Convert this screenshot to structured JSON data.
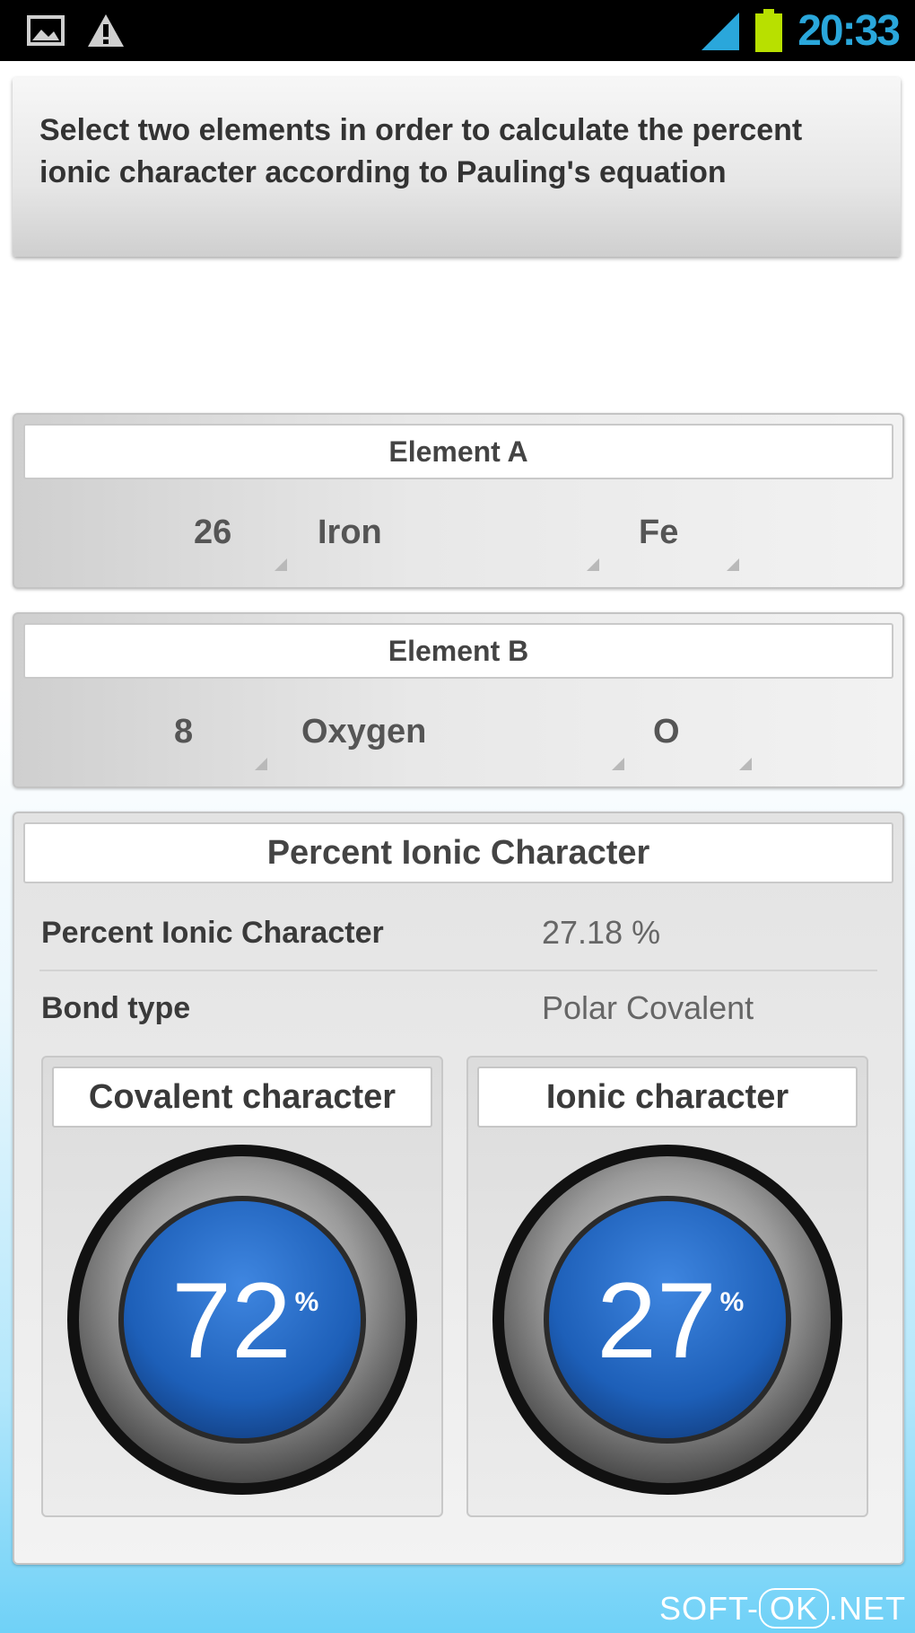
{
  "status_bar": {
    "time": "20:33",
    "icons": [
      "picture-icon",
      "warning-icon",
      "signal-icon",
      "battery-icon"
    ],
    "accent_color": "#2aa7db"
  },
  "instruction": {
    "text": "Select two elements in order to calculate the percent ionic character according to Pauling's equation"
  },
  "element_a": {
    "header": "Element A",
    "atomic_number": "26",
    "name": "Iron",
    "symbol": "Fe"
  },
  "element_b": {
    "header": "Element B",
    "atomic_number": "8",
    "name": "Oxygen",
    "symbol": "O"
  },
  "results": {
    "header": "Percent Ionic Character",
    "percent_label": "Percent Ionic Character",
    "percent_value": "27.18 %",
    "bond_label": "Bond type",
    "bond_value": "Polar Covalent",
    "covalent": {
      "title": "Covalent character",
      "value": "72",
      "unit": "%"
    },
    "ionic": {
      "title": "Ionic character",
      "value": "27",
      "unit": "%"
    },
    "gauge_color": "#1d5fb8"
  },
  "watermark": {
    "prefix": "SOFT-",
    "badge": "OK",
    "suffix": ".NET"
  }
}
